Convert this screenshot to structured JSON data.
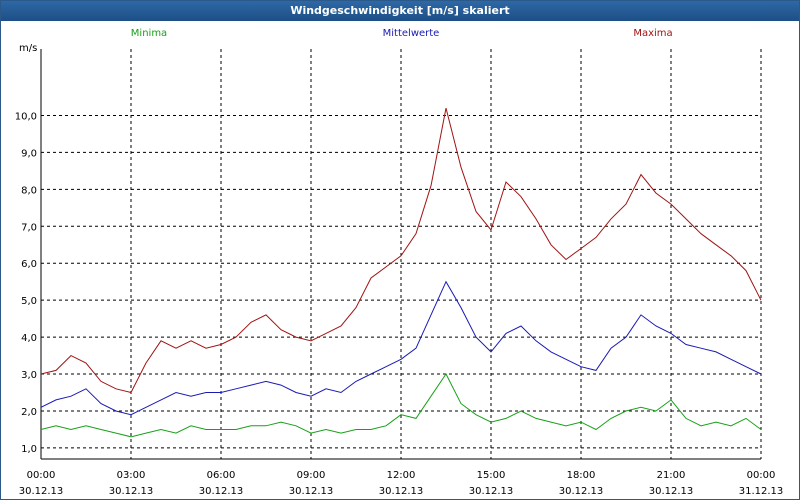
{
  "chart_data": {
    "type": "line",
    "title": "Windgeschwindigkeit [m/s] skaliert",
    "ylabel": "m/s",
    "ylim": [
      0.7,
      11.8
    ],
    "yticks": [
      "1,0",
      "2,0",
      "3,0",
      "4,0",
      "5,0",
      "6,0",
      "7,0",
      "8,0",
      "9,0",
      "10,0"
    ],
    "ytick_values": [
      1,
      2,
      3,
      4,
      5,
      6,
      7,
      8,
      9,
      10
    ],
    "xticks": [
      {
        "time": "00:00",
        "date": "30.12.13"
      },
      {
        "time": "03:00",
        "date": "30.12.13"
      },
      {
        "time": "06:00",
        "date": "30.12.13"
      },
      {
        "time": "09:00",
        "date": "30.12.13"
      },
      {
        "time": "12:00",
        "date": "30.12.13"
      },
      {
        "time": "15:00",
        "date": "30.12.13"
      },
      {
        "time": "18:00",
        "date": "30.12.13"
      },
      {
        "time": "21:00",
        "date": "30.12.13"
      },
      {
        "time": "00:00",
        "date": "31.12.13"
      }
    ],
    "x_hours": [
      0,
      24
    ],
    "grid": true,
    "legend_position": "top",
    "series": [
      {
        "name": "Minima",
        "color": "#18a018",
        "points": [
          [
            0,
            1.5
          ],
          [
            0.5,
            1.6
          ],
          [
            1,
            1.5
          ],
          [
            1.5,
            1.6
          ],
          [
            2,
            1.5
          ],
          [
            2.5,
            1.4
          ],
          [
            3,
            1.3
          ],
          [
            3.5,
            1.4
          ],
          [
            4,
            1.5
          ],
          [
            4.5,
            1.4
          ],
          [
            5,
            1.6
          ],
          [
            5.5,
            1.5
          ],
          [
            6,
            1.5
          ],
          [
            6.5,
            1.5
          ],
          [
            7,
            1.6
          ],
          [
            7.5,
            1.6
          ],
          [
            8,
            1.7
          ],
          [
            8.5,
            1.6
          ],
          [
            9,
            1.4
          ],
          [
            9.5,
            1.5
          ],
          [
            10,
            1.4
          ],
          [
            10.5,
            1.5
          ],
          [
            11,
            1.5
          ],
          [
            11.5,
            1.6
          ],
          [
            12,
            1.9
          ],
          [
            12.5,
            1.8
          ],
          [
            13,
            2.4
          ],
          [
            13.5,
            3.0
          ],
          [
            14,
            2.2
          ],
          [
            14.5,
            1.9
          ],
          [
            15,
            1.7
          ],
          [
            15.5,
            1.8
          ],
          [
            16,
            2.0
          ],
          [
            16.5,
            1.8
          ],
          [
            17,
            1.7
          ],
          [
            17.5,
            1.6
          ],
          [
            18,
            1.7
          ],
          [
            18.5,
            1.5
          ],
          [
            19,
            1.8
          ],
          [
            19.5,
            2.0
          ],
          [
            20,
            2.1
          ],
          [
            20.5,
            2.0
          ],
          [
            21,
            2.3
          ],
          [
            21.5,
            1.8
          ],
          [
            22,
            1.6
          ],
          [
            22.5,
            1.7
          ],
          [
            23,
            1.6
          ],
          [
            23.5,
            1.8
          ],
          [
            24,
            1.5
          ]
        ]
      },
      {
        "name": "Mittelwerte",
        "color": "#1a1ab4",
        "points": [
          [
            0,
            2.1
          ],
          [
            0.5,
            2.3
          ],
          [
            1,
            2.4
          ],
          [
            1.5,
            2.6
          ],
          [
            2,
            2.2
          ],
          [
            2.5,
            2.0
          ],
          [
            3,
            1.9
          ],
          [
            3.5,
            2.1
          ],
          [
            4,
            2.3
          ],
          [
            4.5,
            2.5
          ],
          [
            5,
            2.4
          ],
          [
            5.5,
            2.5
          ],
          [
            6,
            2.5
          ],
          [
            6.5,
            2.6
          ],
          [
            7,
            2.7
          ],
          [
            7.5,
            2.8
          ],
          [
            8,
            2.7
          ],
          [
            8.5,
            2.5
          ],
          [
            9,
            2.4
          ],
          [
            9.5,
            2.6
          ],
          [
            10,
            2.5
          ],
          [
            10.5,
            2.8
          ],
          [
            11,
            3.0
          ],
          [
            11.5,
            3.2
          ],
          [
            12,
            3.4
          ],
          [
            12.5,
            3.7
          ],
          [
            13,
            4.6
          ],
          [
            13.5,
            5.5
          ],
          [
            14,
            4.8
          ],
          [
            14.5,
            4.0
          ],
          [
            15,
            3.6
          ],
          [
            15.5,
            4.1
          ],
          [
            16,
            4.3
          ],
          [
            16.5,
            3.9
          ],
          [
            17,
            3.6
          ],
          [
            17.5,
            3.4
          ],
          [
            18,
            3.2
          ],
          [
            18.5,
            3.1
          ],
          [
            19,
            3.7
          ],
          [
            19.5,
            4.0
          ],
          [
            20,
            4.6
          ],
          [
            20.5,
            4.3
          ],
          [
            21,
            4.1
          ],
          [
            21.5,
            3.8
          ],
          [
            22,
            3.7
          ],
          [
            22.5,
            3.6
          ],
          [
            23,
            3.4
          ],
          [
            23.5,
            3.2
          ],
          [
            24,
            3.0
          ]
        ]
      },
      {
        "name": "Maxima",
        "color": "#a01414",
        "points": [
          [
            0,
            3.0
          ],
          [
            0.5,
            3.1
          ],
          [
            1,
            3.5
          ],
          [
            1.5,
            3.3
          ],
          [
            2,
            2.8
          ],
          [
            2.5,
            2.6
          ],
          [
            3,
            2.5
          ],
          [
            3.5,
            3.3
          ],
          [
            4,
            3.9
          ],
          [
            4.5,
            3.7
          ],
          [
            5,
            3.9
          ],
          [
            5.5,
            3.7
          ],
          [
            6,
            3.8
          ],
          [
            6.5,
            4.0
          ],
          [
            7,
            4.4
          ],
          [
            7.5,
            4.6
          ],
          [
            8,
            4.2
          ],
          [
            8.5,
            4.0
          ],
          [
            9,
            3.9
          ],
          [
            9.5,
            4.1
          ],
          [
            10,
            4.3
          ],
          [
            10.5,
            4.8
          ],
          [
            11,
            5.6
          ],
          [
            11.5,
            5.9
          ],
          [
            12,
            6.2
          ],
          [
            12.5,
            6.8
          ],
          [
            13,
            8.1
          ],
          [
            13.5,
            10.2
          ],
          [
            14,
            8.6
          ],
          [
            14.5,
            7.4
          ],
          [
            15,
            6.9
          ],
          [
            15.5,
            8.2
          ],
          [
            16,
            7.8
          ],
          [
            16.5,
            7.2
          ],
          [
            17,
            6.5
          ],
          [
            17.5,
            6.1
          ],
          [
            18,
            6.4
          ],
          [
            18.5,
            6.7
          ],
          [
            19,
            7.2
          ],
          [
            19.5,
            7.6
          ],
          [
            20,
            8.4
          ],
          [
            20.5,
            7.9
          ],
          [
            21,
            7.6
          ],
          [
            21.5,
            7.2
          ],
          [
            22,
            6.8
          ],
          [
            22.5,
            6.5
          ],
          [
            23,
            6.2
          ],
          [
            23.5,
            5.8
          ],
          [
            24,
            5.0
          ]
        ]
      }
    ]
  }
}
